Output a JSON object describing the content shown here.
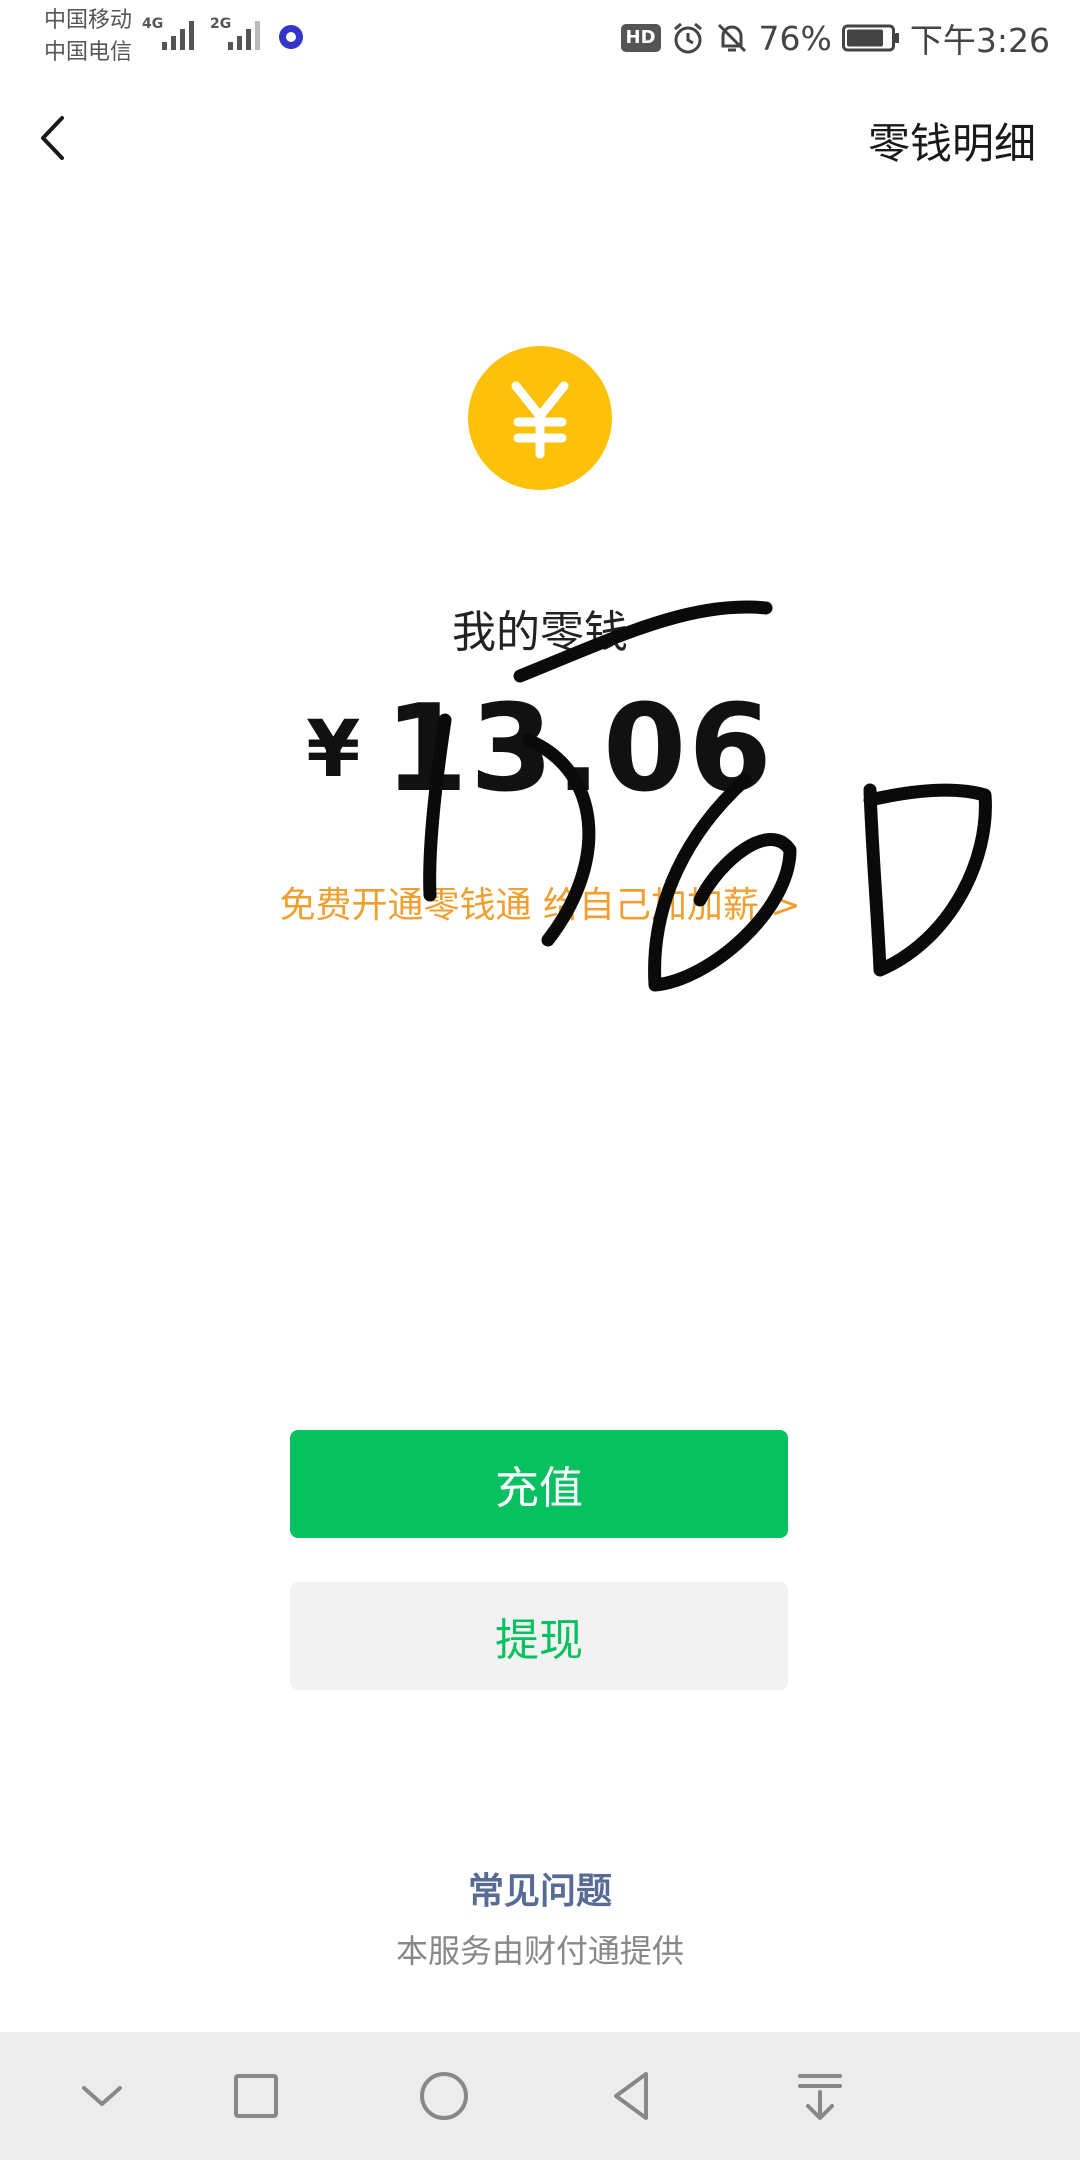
{
  "status_bar": {
    "carrier_1": "中国移动",
    "carrier_2": "中国电信",
    "net_1": "4G",
    "net_2": "2G",
    "hd": "HD",
    "battery": "76%",
    "time": "下午3:26"
  },
  "nav": {
    "title": "零钱明细"
  },
  "balance": {
    "coin_symbol": "¥",
    "label": "我的零钱",
    "currency": "¥",
    "amount": "13.06",
    "promo": "免费开通零钱通 给自己加加薪 >"
  },
  "buttons": {
    "recharge": "充值",
    "withdraw": "提现"
  },
  "footer": {
    "faq": "常见问题",
    "provider": "本服务由财付通提供"
  },
  "colors": {
    "accent_green": "#07c160",
    "coin_yellow": "#fcc108",
    "promo_orange": "#f0a030",
    "link_blue": "#576b95"
  }
}
